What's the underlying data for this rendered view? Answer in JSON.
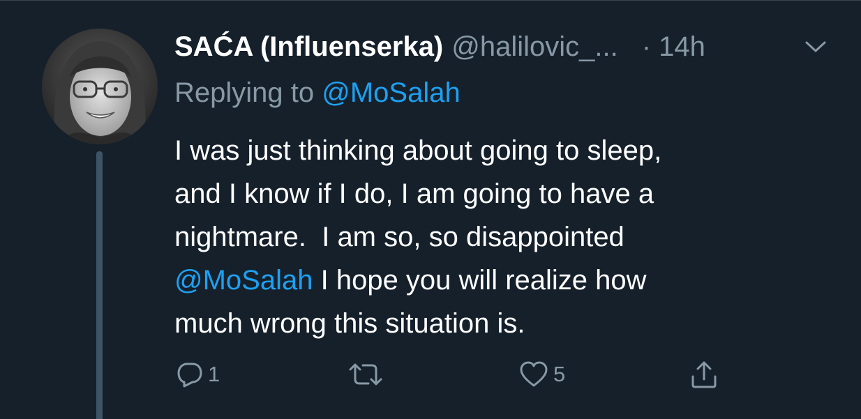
{
  "tweet": {
    "display_name": "SAĆA (Influenserka)",
    "handle": "@halilovic_...",
    "time": "· 14h",
    "replying_prefix": "Replying to ",
    "replying_to": "@MoSalah",
    "body": {
      "line1": "I was just thinking about going to sleep,",
      "line2": "and I know if I do, I am going to have a",
      "line3": "nightmare.  I am so, so disappointed",
      "line4_mention": "@MoSalah",
      "line4_rest": " I hope you will realize how",
      "line5": "much wrong this situation is."
    },
    "actions": {
      "reply_count": "1",
      "retweet_count": "",
      "like_count": "5"
    }
  },
  "icons": {
    "reply": "reply-icon",
    "retweet": "retweet-icon",
    "like": "heart-icon",
    "share": "share-icon",
    "caret": "chevron-down-icon"
  },
  "colors": {
    "background": "#15202b",
    "text": "#ffffff",
    "secondary": "#8899a6",
    "accent": "#1da1f2",
    "thread_line": "#3d5466"
  }
}
